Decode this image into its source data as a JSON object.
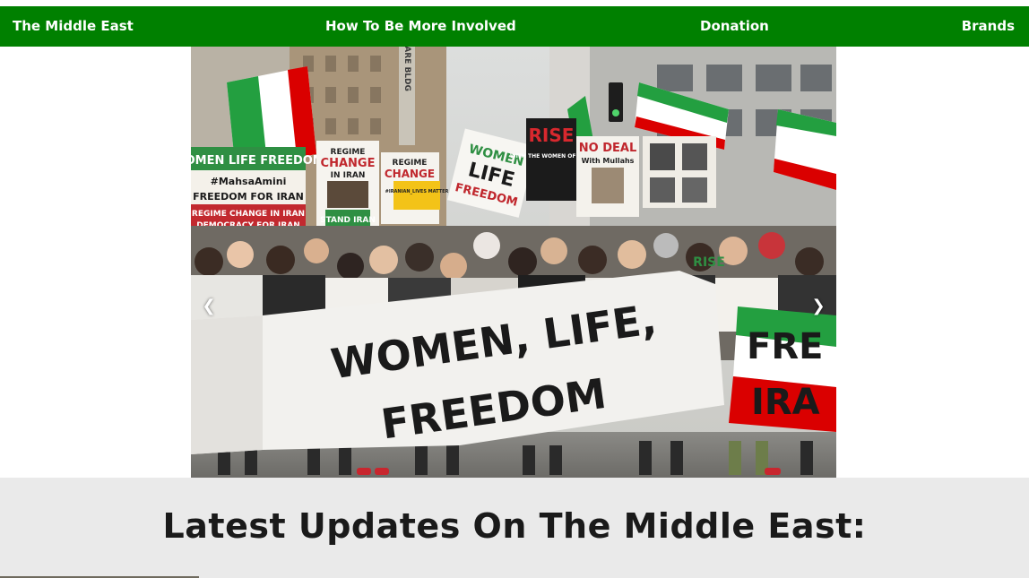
{
  "nav": {
    "items": [
      {
        "label": "The Middle East"
      },
      {
        "label": "How To Be More Involved"
      },
      {
        "label": "Donation"
      },
      {
        "label": "Brands"
      }
    ]
  },
  "slideshow": {
    "prev_arrow": "❮",
    "next_arrow": "❯",
    "banner_line1": "WOMEN, LIFE,",
    "banner_line2": "FREEDOM",
    "signs": {
      "women_life_freedom": "WOMEN LIFE FREEDOM",
      "mahsa_amini": "#MahsaAmini",
      "freedom_for_iran": "FREEDOM FOR IRAN",
      "regime_change_iran": "REGIME CHANGE IN IRAN",
      "democracy_for_iran": "DEMOCRACY FOR IRAN",
      "regime_change_1": "REGIME",
      "regime_change_2": "CHANGE",
      "in_iran": "IN IRAN",
      "stand_with_iran": "STAND IRAN",
      "regime_2": "REGIME",
      "change_2": "CHANGE",
      "iranian_lives_matter": "#IRANIAN_LIVES MATTER",
      "women_sign": "WOMEN",
      "life_sign": "LIFE",
      "freedom_sign": "FREEDOM",
      "rise": "RISE",
      "with_the_women": "WITH THE WOMEN OF IRAN",
      "no_deal": "NO DEAL",
      "with_mullahs": "With Mullahs",
      "square_bldg": "SQUARE BLDG",
      "fre": "FRE",
      "ira": "IRA",
      "rise_shirt": "RISE"
    }
  },
  "updates": {
    "title": "Latest Updates On The Middle East:"
  },
  "colors": {
    "nav_bg": "#008000",
    "nav_text": "#ffffff",
    "updates_bg": "#eaeaea",
    "iran_green": "#239f40",
    "iran_red": "#da0000"
  }
}
